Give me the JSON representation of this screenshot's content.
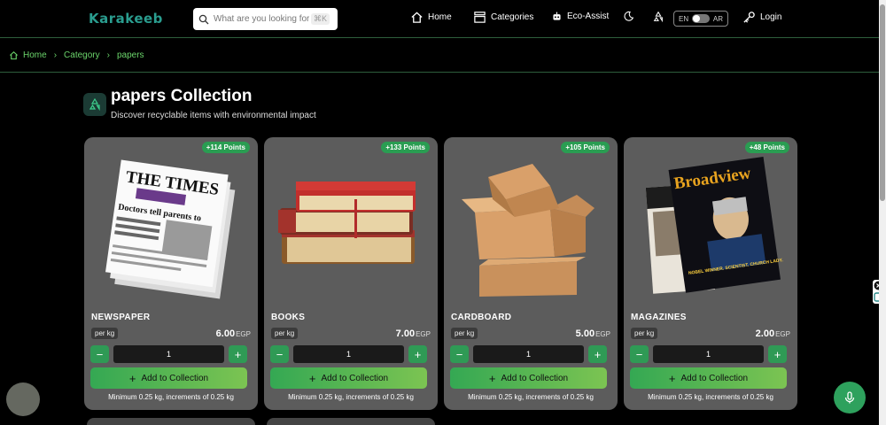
{
  "header": {
    "logo": "Karakeeb",
    "search_placeholder": "What are you looking for?",
    "search_shortcut": "⌘K",
    "nav": {
      "home": "Home",
      "categories": "Categories",
      "eco_assist": "Eco-Assist",
      "login": "Login"
    },
    "lang": {
      "en": "EN",
      "ar": "AR"
    }
  },
  "breadcrumb": {
    "home": "Home",
    "category": "Category",
    "current": "papers"
  },
  "page": {
    "title": "papers Collection",
    "subtitle": "Discover recyclable items with environmental impact"
  },
  "products": [
    {
      "name": "NEWSPAPER",
      "points": "+114 Points",
      "unit": "per kg",
      "price": "6.00",
      "currency": "EGP",
      "quantity": "1",
      "add_label": "Add to Collection",
      "minimum": "Minimum 0.25 kg, increments of 0.25 kg"
    },
    {
      "name": "BOOKS",
      "points": "+133 Points",
      "unit": "per kg",
      "price": "7.00",
      "currency": "EGP",
      "quantity": "1",
      "add_label": "Add to Collection",
      "minimum": "Minimum 0.25 kg, increments of 0.25 kg"
    },
    {
      "name": "CARDBOARD",
      "points": "+105 Points",
      "unit": "per kg",
      "price": "5.00",
      "currency": "EGP",
      "quantity": "1",
      "add_label": "Add to Collection",
      "minimum": "Minimum 0.25 kg, increments of 0.25 kg"
    },
    {
      "name": "MAGAZINES",
      "points": "+48 Points",
      "unit": "per kg",
      "price": "2.00",
      "currency": "EGP",
      "quantity": "1",
      "add_label": "Add to Collection",
      "minimum": "Minimum 0.25 kg, increments of 0.25 kg"
    }
  ],
  "images": {
    "newspaper_masthead": "THE TIMES",
    "newspaper_headline": "Doctors tell parents to",
    "magazine_masthead": "Broadview",
    "magazine_cover_line": "NOBEL WINNER. SCIENTIST. CHURCH LADY."
  },
  "colors": {
    "accent": "#2a9d52",
    "logo": "#2a9d8f",
    "breadcrumb": "#6bd56b",
    "card": "#5c5c5c"
  }
}
